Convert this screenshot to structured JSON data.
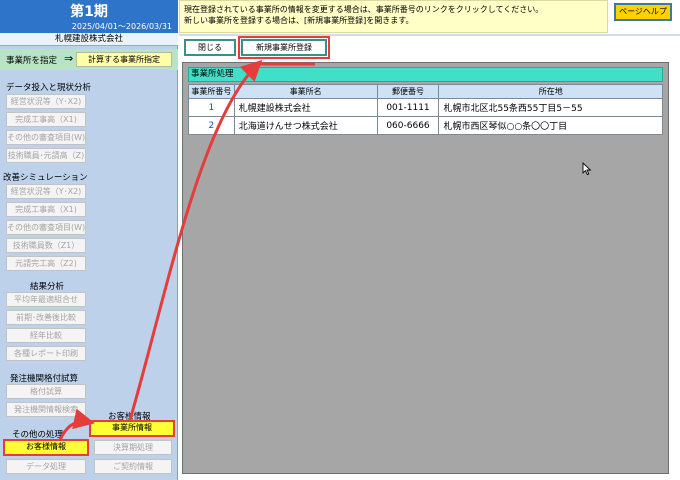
{
  "sidebar": {
    "period_title": "第1期",
    "period_range": "2025/04/01～2026/03/31",
    "company_name": "札幌建設株式会社",
    "office_label": "事業所を指定",
    "arrow": "⇒",
    "target_button": "計算する事業所指定",
    "sections": {
      "input": "データ投入と現状分析",
      "simulation": "改善シミュレーション",
      "result": "結果分析",
      "order": "発注機関格付試算",
      "other": "その他の処理",
      "customer": "お客様情報"
    },
    "buttons": {
      "btn1": "経営状況等（Y･X2)",
      "btn2": "完成工事高（X1)",
      "btn3": "その他の審査項目(W)",
      "btn4": "技術職員･元請高（Z)",
      "btn5": "経営状況等（Y･X2)",
      "btn6": "完成工事高（X1)",
      "btn7": "その他の審査項目(W)",
      "btn8": "技術職員数（Z1）",
      "btn9": "元請完工高（Z2)",
      "btn10": "平均年最適組合せ",
      "btn11": "前期･改善後比較",
      "btn12": "経年比較",
      "btn13": "各種レポート印刷",
      "btn14": "格付試算",
      "btn15": "発注機関情報検索",
      "btn_customer": "お客様情報",
      "btn_data": "データ処理",
      "btn_office": "事業所情報",
      "btn_settlement": "決算期処理",
      "btn_contract": "ご契約情報"
    }
  },
  "main": {
    "info_line1": "現在登録されている事業所の情報を変更する場合は、事業所番号のリンクをクリックしてください。",
    "info_line2": "新しい事業所を登録する場合は、[新規事業所登録]を開きます。",
    "help_button": "ページヘルプ",
    "close_button": "閉じる",
    "new_button": "新規事業所登録",
    "panel_title": "事業所処理",
    "table": {
      "headers": [
        "事業所番号",
        "事業所名",
        "郵便番号",
        "所在地"
      ],
      "rows": [
        [
          "1",
          "札幌建設株式会社",
          "001-1111",
          "札幌市北区北55条西55丁目5－55"
        ],
        [
          "2",
          "北海道けんせつ株式会社",
          "060-6666",
          "札幌市西区琴似○○条〇〇丁目"
        ]
      ]
    }
  },
  "colors": {
    "sidebar_bg": "#bdd1ea",
    "period_bg": "#2e74c8",
    "highlight_yellow": "#ffff33",
    "annotation_red": "#e53c3c",
    "panel_header": "#40e0c8",
    "panel_bg": "#a6a6a6"
  }
}
